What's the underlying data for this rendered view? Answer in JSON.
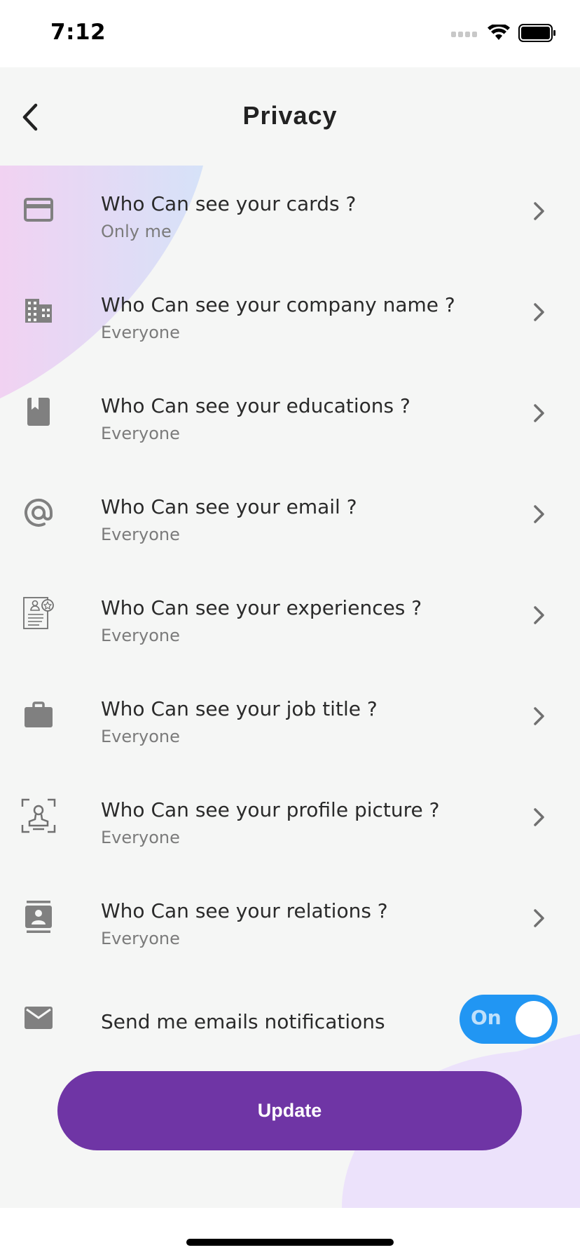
{
  "status_bar": {
    "time": "7:12",
    "icons": [
      "signal-icon",
      "wifi-icon",
      "battery-icon"
    ]
  },
  "header": {
    "title": "Privacy",
    "back_icon": "chevron-left-icon"
  },
  "privacy_items": [
    {
      "icon": "card-icon",
      "title": "Who Can see your cards ?",
      "value": "Only me"
    },
    {
      "icon": "building-icon",
      "title": "Who Can see your company name ?",
      "value": "Everyone"
    },
    {
      "icon": "book-icon",
      "title": "Who Can see your educations ?",
      "value": "Everyone"
    },
    {
      "icon": "at-sign-icon",
      "title": "Who Can see your email ?",
      "value": "Everyone"
    },
    {
      "icon": "resume-icon",
      "title": "Who Can see your experiences ?",
      "value": "Everyone"
    },
    {
      "icon": "briefcase-icon",
      "title": "Who Can see your job title ?",
      "value": "Everyone"
    },
    {
      "icon": "profile-picture-icon",
      "title": "Who Can see your profile picture ?",
      "value": "Everyone"
    },
    {
      "icon": "contact-card-icon",
      "title": "Who Can see your relations ?",
      "value": "Everyone"
    }
  ],
  "email_notifications": {
    "icon": "envelope-icon",
    "label": "Send me emails notifications",
    "toggle_text": "On",
    "enabled": true
  },
  "update_button": {
    "label": "Update"
  },
  "colors": {
    "accent": "#6f35a5",
    "toggle_on": "#2196f3",
    "background": "#f5f6f5",
    "icon_gray": "#808080"
  }
}
